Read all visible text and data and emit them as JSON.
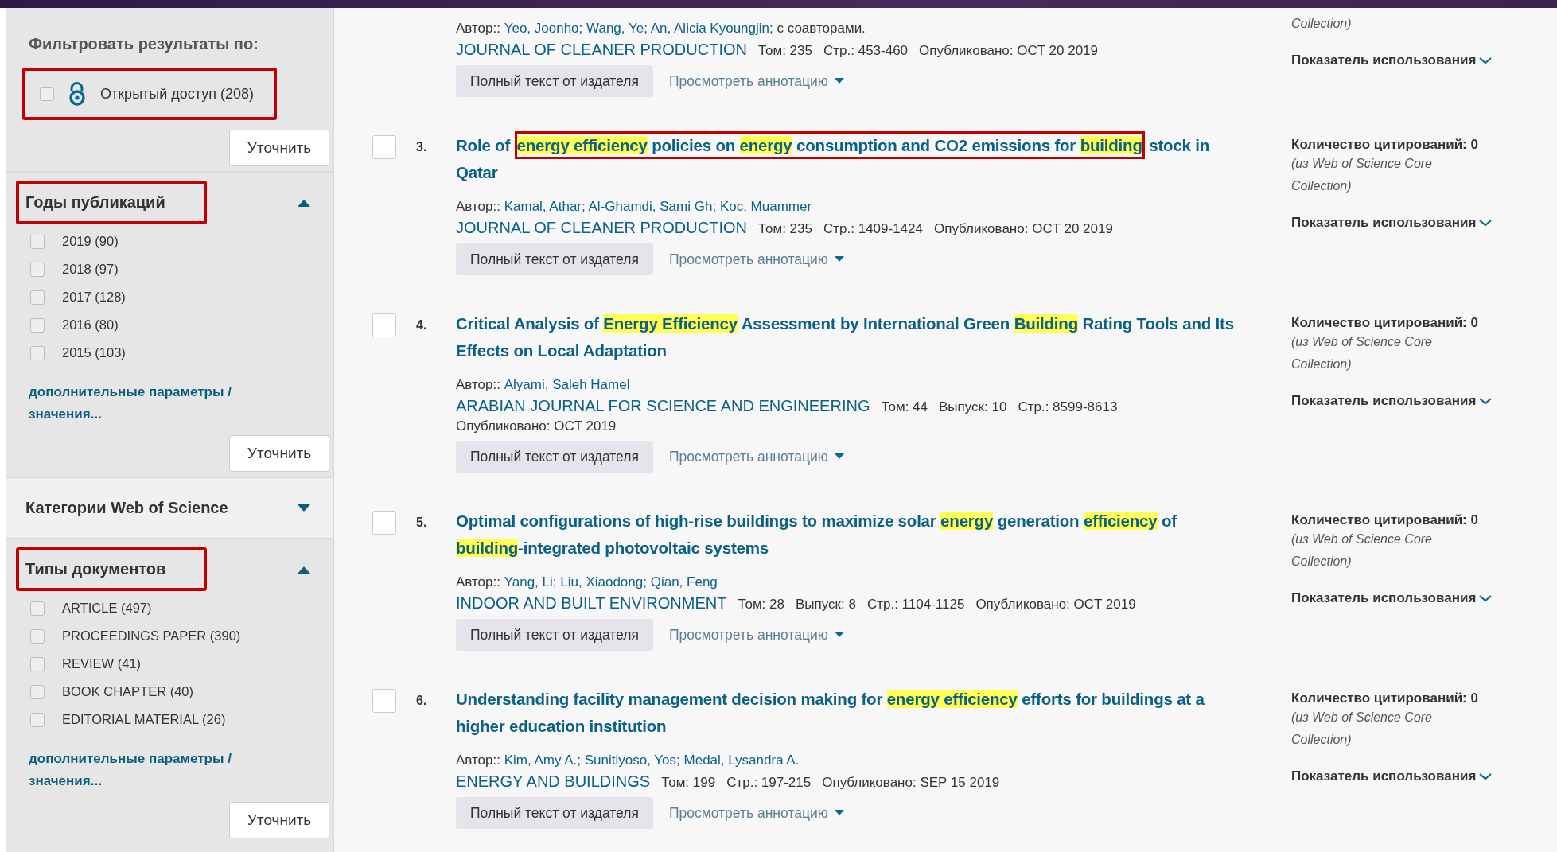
{
  "sidebar": {
    "heading": "Фильтровать результаты по:",
    "open_access": {
      "label": "Открытый доступ (208)",
      "checked": false,
      "annotated": true
    },
    "refine_button": "Уточнить",
    "sections": [
      {
        "title": "Годы публикаций",
        "expanded": true,
        "annotated": true,
        "options": [
          {
            "label": "2019 (90)",
            "checked": false
          },
          {
            "label": "2018 (97)",
            "checked": false
          },
          {
            "label": "2017 (128)",
            "checked": false
          },
          {
            "label": "2016 (80)",
            "checked": false
          },
          {
            "label": "2015 (103)",
            "checked": false
          }
        ],
        "more_link": "дополнительные параметры / значения...",
        "refine_button": "Уточнить"
      },
      {
        "title": "Категории Web of Science",
        "expanded": false,
        "annotated": false
      },
      {
        "title": "Типы документов",
        "expanded": true,
        "annotated": true,
        "options": [
          {
            "label": "ARTICLE (497)",
            "checked": false
          },
          {
            "label": "PROCEEDINGS PAPER (390)",
            "checked": false
          },
          {
            "label": "REVIEW (41)",
            "checked": false
          },
          {
            "label": "BOOK CHAPTER (40)",
            "checked": false
          },
          {
            "label": "EDITORIAL MATERIAL (26)",
            "checked": false
          }
        ],
        "more_link": "дополнительные параметры / значения...",
        "refine_button": "Уточнить"
      }
    ]
  },
  "results": [
    {
      "author_label": "Автор::",
      "authors": [
        "Yeo, Joonho;",
        "Wang, Ye;",
        "An, Alicia Kyoungjin;"
      ],
      "authors_more": "с соавторами.",
      "journal": "JOURNAL OF CLEANER PRODUCTION",
      "details": [
        "Том: 235",
        "Стр.: 453-460",
        "Опубликовано: OCT 20 2019"
      ],
      "full_text_button": "Полный текст от издателя",
      "abstract_link": "Просмотреть аннотацию",
      "citation_source": "Collection)",
      "usage": "Показатель использования"
    },
    {
      "number": "3.",
      "checked": false,
      "title": [
        {
          "text": "Role of ",
          "highlight": false,
          "annotated": false
        },
        {
          "text": "energy efficiency",
          "highlight": true,
          "annotated": true
        },
        {
          "text": " policies on ",
          "highlight": false,
          "annotated": true
        },
        {
          "text": "energy",
          "highlight": true,
          "annotated": true
        },
        {
          "text": " consumption and CO2 emissions for ",
          "highlight": false,
          "annotated": true
        },
        {
          "text": "building",
          "highlight": true,
          "annotated": true
        },
        {
          "text": " stock in Qatar",
          "highlight": false,
          "annotated": false
        }
      ],
      "author_label": "Автор::",
      "authors": [
        "Kamal, Athar;",
        "Al-Ghamdi, Sami Gh;",
        "Koc, Muammer"
      ],
      "journal": "JOURNAL OF CLEANER PRODUCTION",
      "details": [
        "Том: 235",
        "Стр.: 1409-1424",
        "Опубликовано: OCT 20 2019"
      ],
      "full_text_button": "Полный текст от издателя",
      "abstract_link": "Просмотреть аннотацию",
      "citations": "Количество цитирований: 0",
      "citation_source": "(из Web of Science Core Collection)",
      "usage": "Показатель использования"
    },
    {
      "number": "4.",
      "checked": false,
      "title": [
        {
          "text": "Critical Analysis of ",
          "highlight": false,
          "annotated": false
        },
        {
          "text": "Energy Efficiency",
          "highlight": true,
          "annotated": false
        },
        {
          "text": " Assessment by International Green ",
          "highlight": false,
          "annotated": false
        },
        {
          "text": "Building",
          "highlight": true,
          "annotated": false
        },
        {
          "text": " Rating Tools and Its Effects on Local Adaptation",
          "highlight": false,
          "annotated": false
        }
      ],
      "author_label": "Автор::",
      "authors": [
        "Alyami, Saleh Hamel"
      ],
      "journal": "ARABIAN JOURNAL FOR SCIENCE AND ENGINEERING",
      "details": [
        "Том: 44",
        "Выпуск: 10",
        "Стр.: 8599-8613",
        "Опубликовано: OCT 2019"
      ],
      "full_text_button": "Полный текст от издателя",
      "abstract_link": "Просмотреть аннотацию",
      "citations": "Количество цитирований: 0",
      "citation_source": "(из Web of Science Core Collection)",
      "usage": "Показатель использования"
    },
    {
      "number": "5.",
      "checked": false,
      "title": [
        {
          "text": "Optimal configurations of high-rise buildings to maximize solar ",
          "highlight": false,
          "annotated": false
        },
        {
          "text": "energy",
          "highlight": true,
          "annotated": false
        },
        {
          "text": " generation ",
          "highlight": false,
          "annotated": false
        },
        {
          "text": "efficiency",
          "highlight": true,
          "annotated": false
        },
        {
          "text": " of ",
          "highlight": false,
          "annotated": false
        },
        {
          "text": "building",
          "highlight": true,
          "annotated": false
        },
        {
          "text": "-integrated photovoltaic systems",
          "highlight": false,
          "annotated": false
        }
      ],
      "author_label": "Автор::",
      "authors": [
        "Yang, Li;",
        "Liu, Xiaodong;",
        "Qian, Feng"
      ],
      "journal": "INDOOR AND BUILT ENVIRONMENT",
      "details": [
        "Том: 28",
        "Выпуск: 8",
        "Стр.: 1104-1125",
        "Опубликовано: OCT 2019"
      ],
      "full_text_button": "Полный текст от издателя",
      "abstract_link": "Просмотреть аннотацию",
      "citations": "Количество цитирований: 0",
      "citation_source": "(из Web of Science Core Collection)",
      "usage": "Показатель использования"
    },
    {
      "number": "6.",
      "checked": false,
      "title": [
        {
          "text": "Understanding facility management decision making for ",
          "highlight": false,
          "annotated": false
        },
        {
          "text": "energy efficiency",
          "highlight": true,
          "annotated": false
        },
        {
          "text": " efforts for buildings at a higher education institution",
          "highlight": false,
          "annotated": false
        }
      ],
      "author_label": "Автор::",
      "authors": [
        "Kim, Amy A.;",
        "Sunitiyoso, Yos;",
        "Medal, Lysandra A."
      ],
      "journal": "ENERGY AND BUILDINGS",
      "details": [
        "Том: 199",
        "Стр.: 197-215",
        "Опубликовано: SEP 15 2019"
      ],
      "full_text_button": "Полный текст от издателя",
      "abstract_link": "Просмотреть аннотацию",
      "citations": "Количество цитирований: 0",
      "citation_source": "(из Web of Science Core Collection)",
      "usage": "Показатель использования"
    }
  ]
}
